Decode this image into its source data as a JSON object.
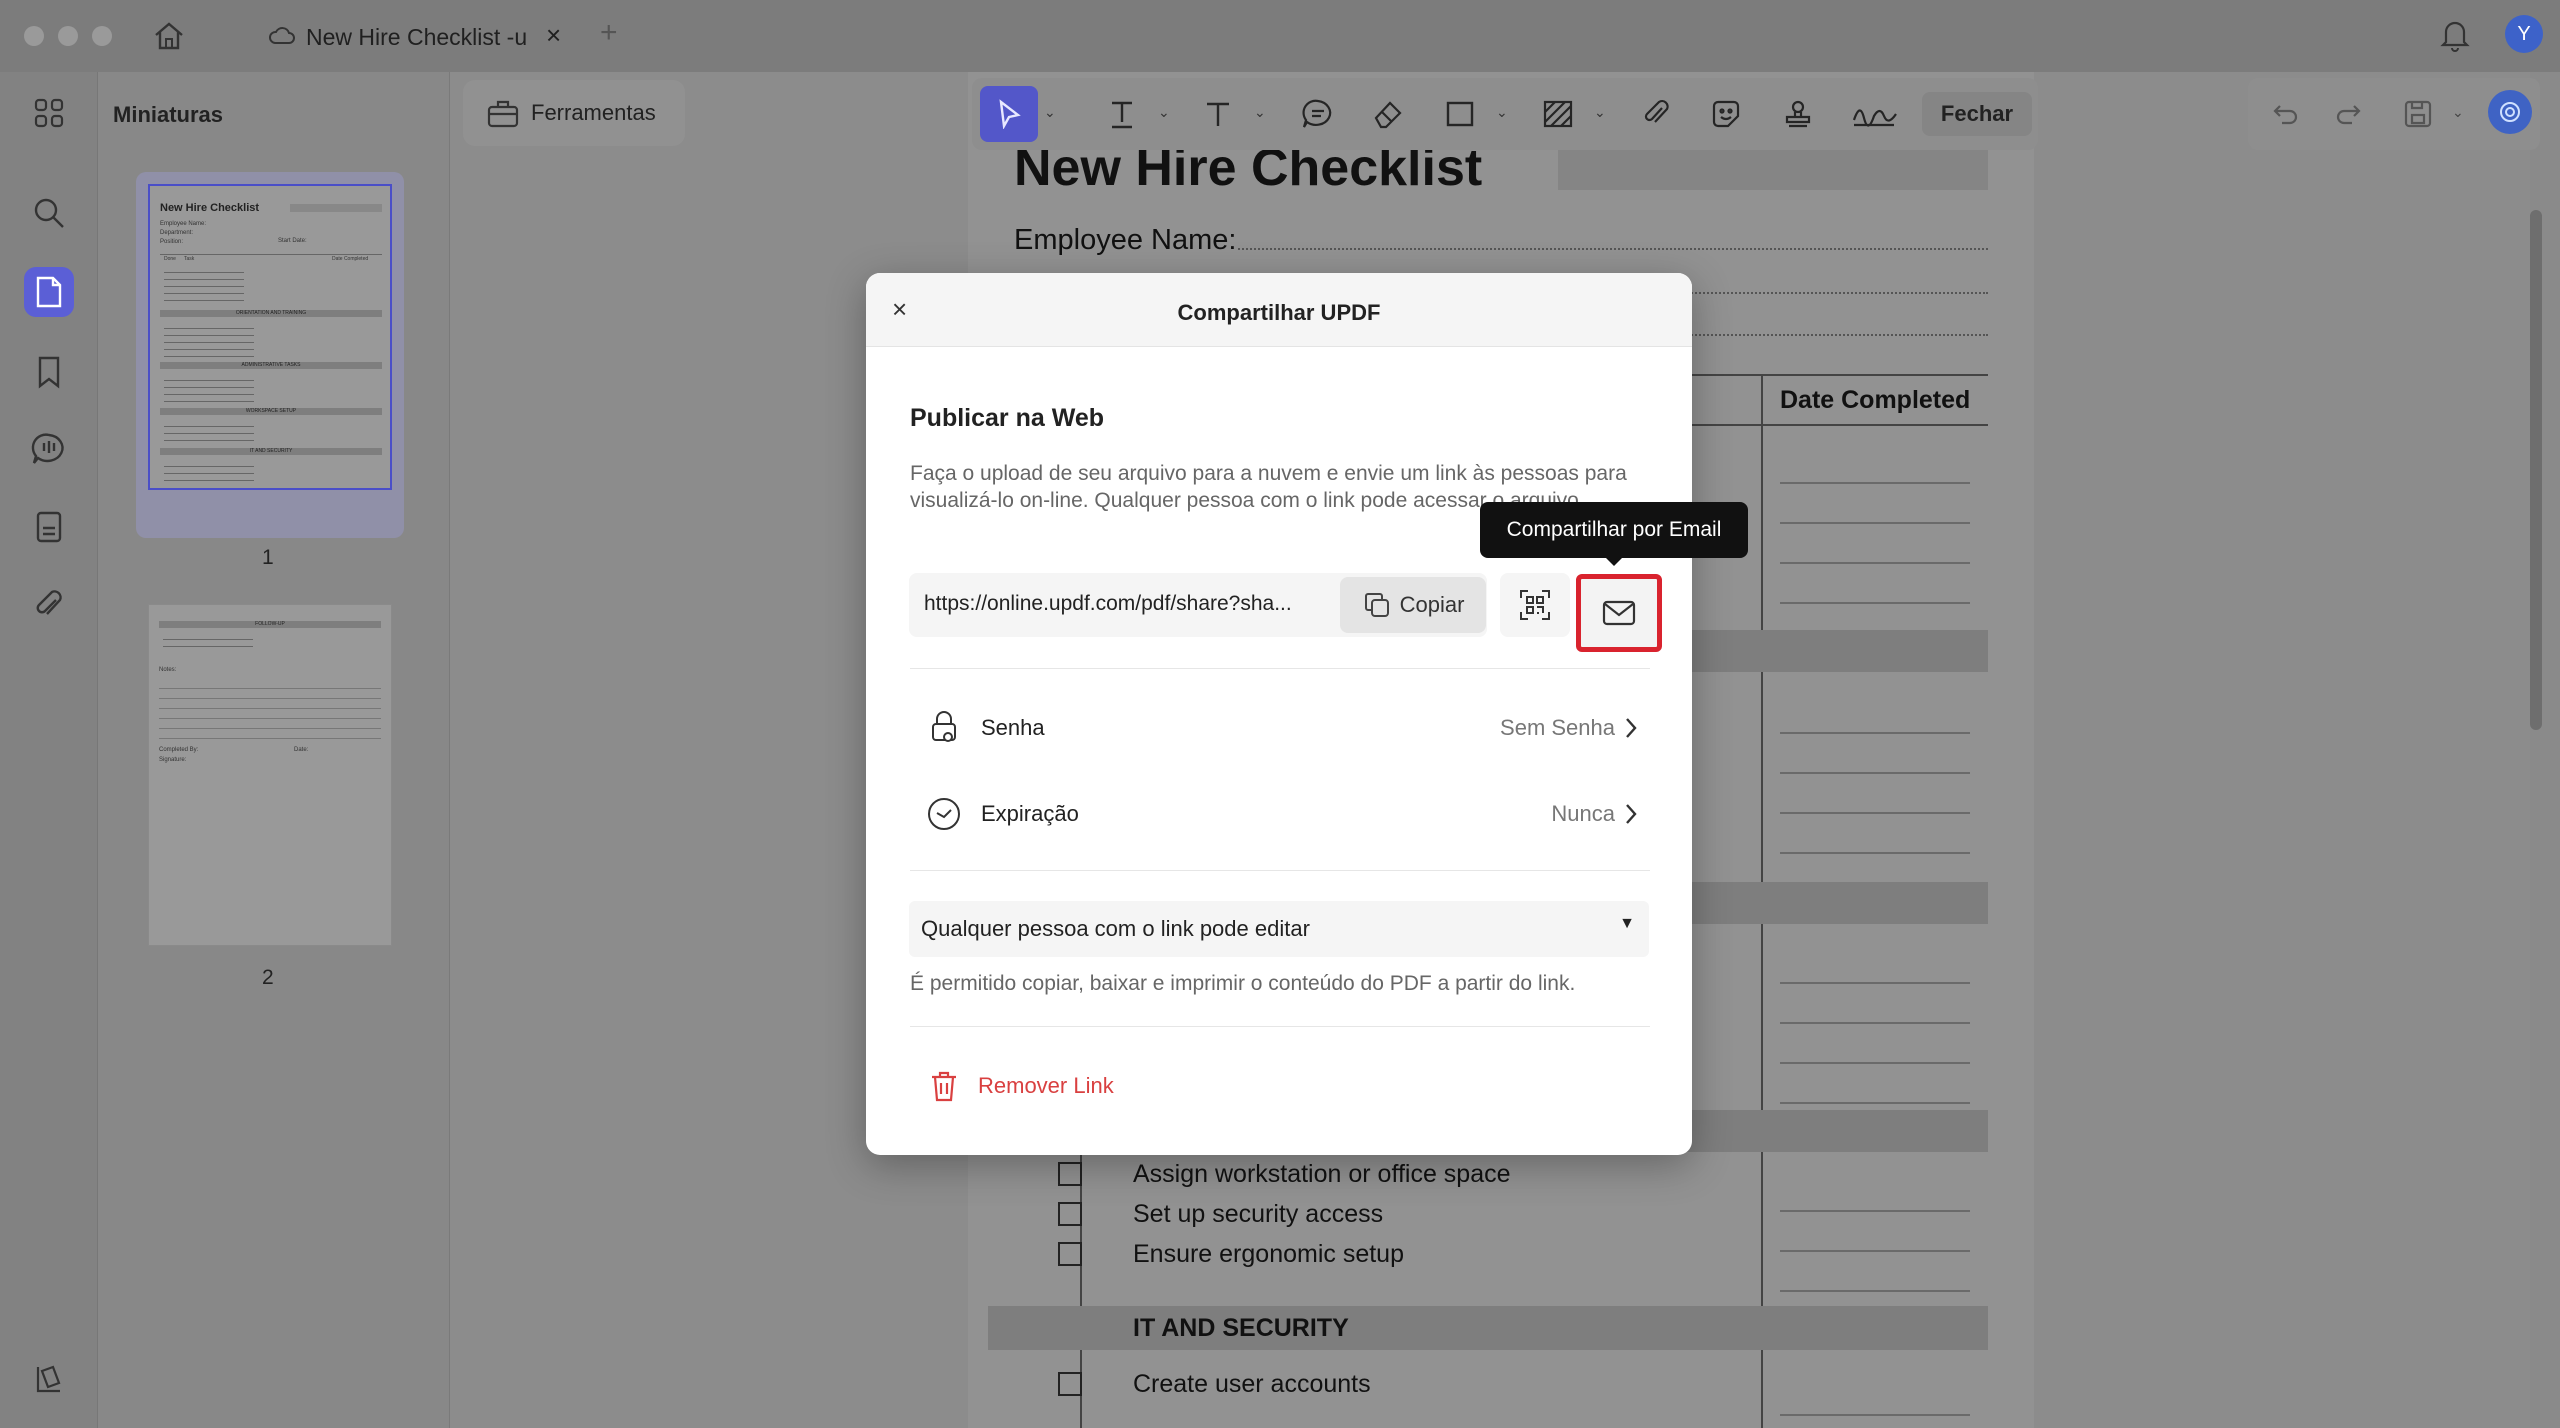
{
  "tab": {
    "title": "New Hire Checklist -u"
  },
  "sidebar": {
    "thumbnails_title": "Miniaturas",
    "pages": [
      "1",
      "2"
    ]
  },
  "toolbar": {
    "tools_label": "Ferramentas",
    "close_label": "Fechar"
  },
  "document": {
    "title": "New Hire Checklist",
    "employee_name": "Employee Name:",
    "date_completed": "Date Completed",
    "items_visible": [
      "Assign workstation or office space",
      "Set up security access",
      "Ensure ergonomic setup"
    ],
    "section_it": "IT AND SECURITY",
    "item_create": "Create user accounts"
  },
  "thumb1": {
    "title": "New Hire Checklist",
    "fields": [
      "Employee Name:",
      "Department:",
      "Position:"
    ],
    "start_date": "Start Date:",
    "headers": [
      "Done",
      "Task",
      "Date Completed"
    ],
    "sections": [
      "ORIENTATION AND TRAINING",
      "ADMINISTRATIVE TASKS",
      "WORKSPACE SETUP",
      "IT AND SECURITY"
    ]
  },
  "thumb2": {
    "section": "FOLLOW-UP",
    "notes": "Notes:",
    "completed_by": "Completed By:",
    "date": "Date:",
    "signature": "Signature:"
  },
  "dialog": {
    "title": "Compartilhar UPDF",
    "section_title": "Publicar na Web",
    "description": "Faça o upload de seu arquivo para a nuvem e envie um link às pessoas para visualizá-lo on-line. Qualquer pessoa com o link pode acessar o arquivo.",
    "url": "https://online.updf.com/pdf/share?sha...",
    "copy_label": "Copiar",
    "tooltip": "Compartilhar por Email",
    "password_label": "Senha",
    "password_value": "Sem Senha",
    "expiration_label": "Expiração",
    "expiration_value": "Nunca",
    "permission_select": "Qualquer pessoa com o link pode editar",
    "permission_note": "É permitido copiar, baixar e imprimir o conteúdo do PDF a partir do link.",
    "remove_label": "Remover Link"
  },
  "user": {
    "avatar_initial": "Y"
  },
  "colors": {
    "accent": "#5b5fd6",
    "highlight": "#d9232e",
    "danger": "#d94040"
  }
}
